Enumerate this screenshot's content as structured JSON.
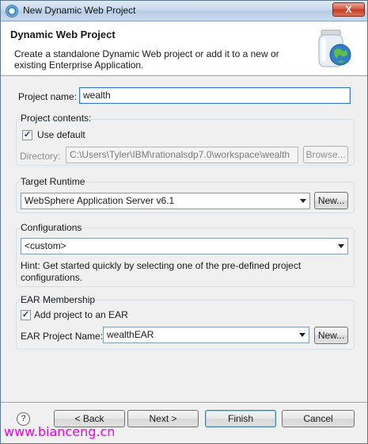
{
  "window": {
    "title": "New Dynamic Web Project",
    "close_glyph": "X"
  },
  "header": {
    "title": "Dynamic Web Project",
    "description": "Create a standalone Dynamic Web project or add it to a new or existing Enterprise Application.",
    "art_icon": "jar-globe-icon"
  },
  "project_name": {
    "label": "Project name:",
    "value": "wealth"
  },
  "project_contents": {
    "title": "Project contents:",
    "use_default_label": "Use default",
    "use_default_checked": true,
    "directory_label": "Directory:",
    "directory_value": "C:\\Users\\Tyler\\IBM\\rationalsdp7.0\\workspace\\wealth",
    "browse_label": "Browse..."
  },
  "target_runtime": {
    "title": "Target Runtime",
    "selected": "WebSphere Application Server v6.1",
    "new_label": "New..."
  },
  "configurations": {
    "title": "Configurations",
    "selected": "<custom>",
    "hint": "Hint: Get started quickly by selecting one of the pre-defined project configurations."
  },
  "ear_membership": {
    "title": "EAR Membership",
    "add_label": "Add project to an EAR",
    "add_checked": true,
    "ear_name_label": "EAR Project Name:",
    "ear_name_value": "wealthEAR",
    "new_label": "New..."
  },
  "footer": {
    "help_glyph": "?",
    "back_label": "< Back",
    "next_label": "Next >",
    "finish_label": "Finish",
    "cancel_label": "Cancel"
  },
  "watermark": "www.bianceng.cn",
  "colors": {
    "accent": "#3a79c4",
    "close": "#c23a21",
    "watermark": "#ee00ee"
  }
}
